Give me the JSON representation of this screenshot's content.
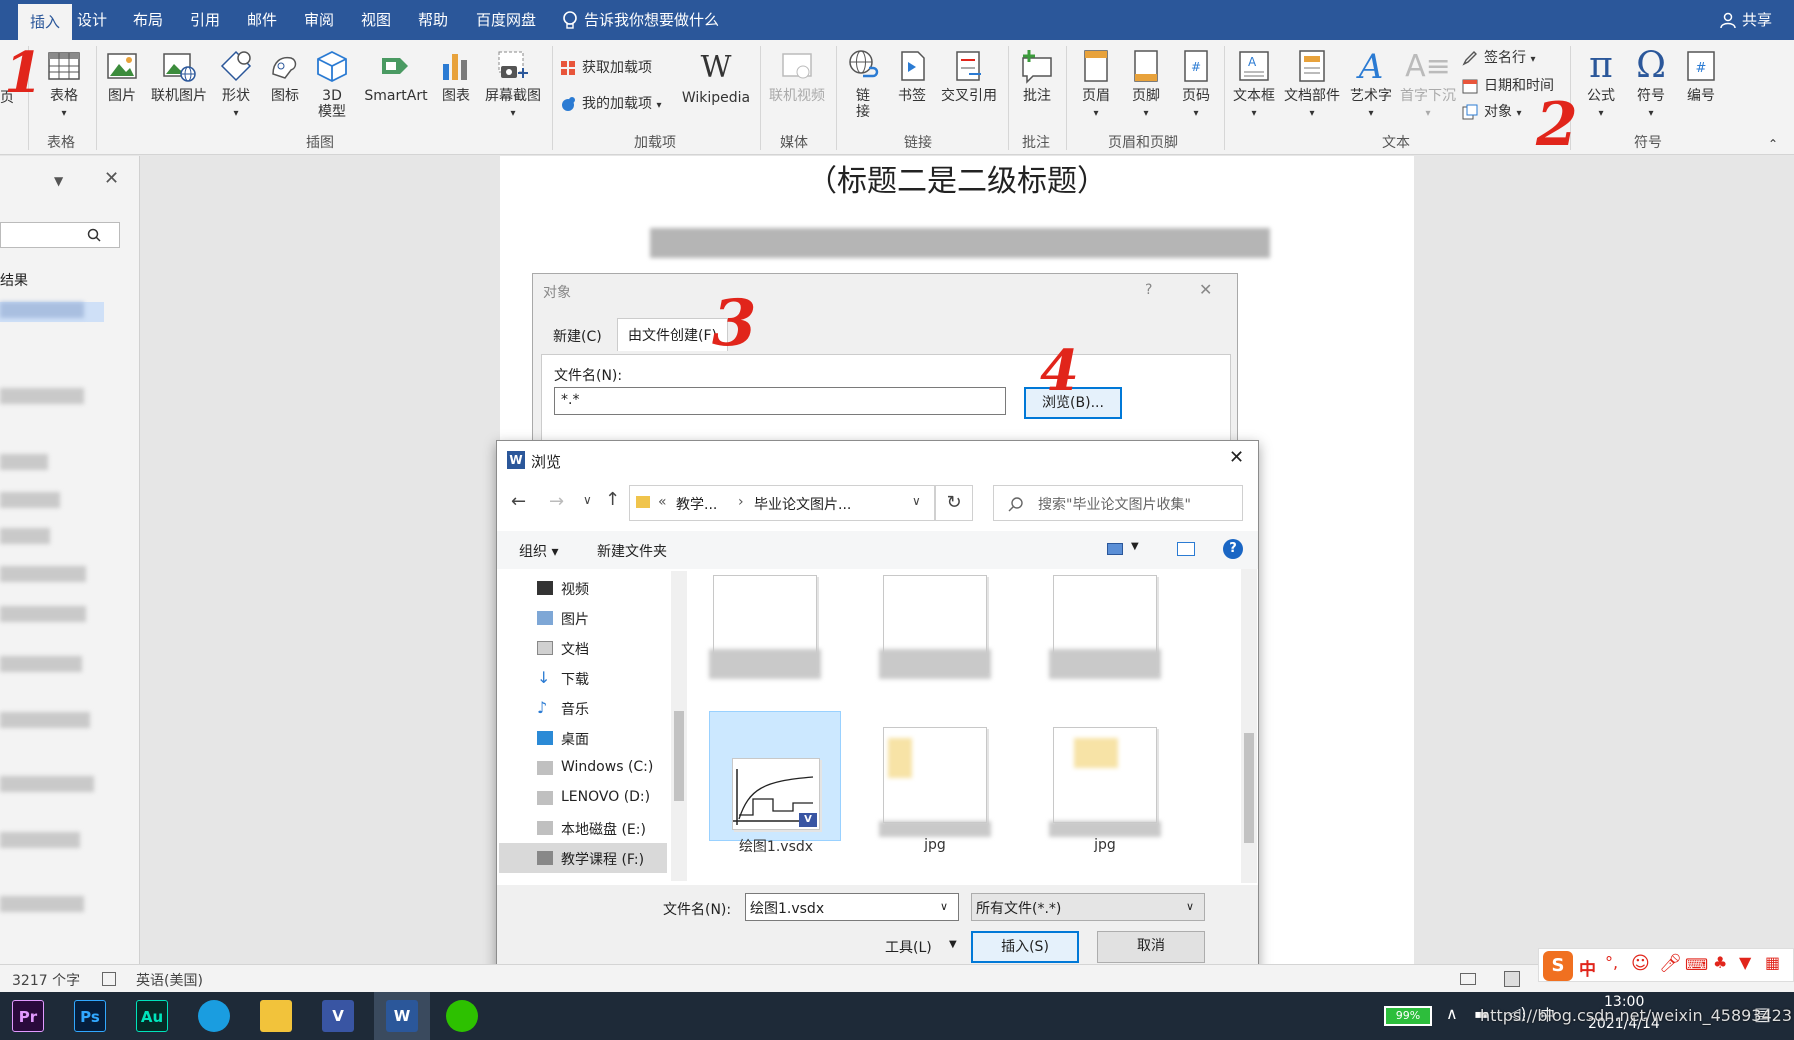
{
  "tabs": [
    "插入",
    "设计",
    "布局",
    "引用",
    "邮件",
    "审阅",
    "视图",
    "帮助",
    "百度网盘"
  ],
  "tell_me": "告诉我你想要做什么",
  "share": "共享",
  "ribbon": {
    "page_partial": "页",
    "table": "表格",
    "picture": "图片",
    "online_picture": "联机图片",
    "shapes": "形状",
    "icons": "图标",
    "model3d_line1": "3D",
    "model3d_line2": "模型",
    "smartart": "SmartArt",
    "chart": "图表",
    "screenshot": "屏幕截图",
    "get_addins": "获取加载项",
    "my_addins": "我的加载项",
    "wikipedia": "Wikipedia",
    "online_video": "联机视频",
    "link_line1": "链",
    "link_line2": "接",
    "bookmark": "书签",
    "crossref": "交叉引用",
    "comment": "批注",
    "header": "页眉",
    "footer": "页脚",
    "page_number": "页码",
    "textbox": "文本框",
    "quickparts": "文档部件",
    "wordart": "艺术字",
    "dropcap": "首字下沉",
    "signature": "签名行",
    "datetime": "日期和时间",
    "object": "对象",
    "equation": "公式",
    "symbol": "符号",
    "number": "编号",
    "groups": {
      "table": "表格",
      "illustrations": "插图",
      "addins": "加载项",
      "media": "媒体",
      "links": "链接",
      "comments": "批注",
      "header_footer": "页眉和页脚",
      "text": "文本",
      "symbols": "符号"
    }
  },
  "navpane": {
    "results": "结果"
  },
  "document": {
    "heading": "（标题二是二级标题）"
  },
  "object_dialog": {
    "title": "对象",
    "help": "?",
    "close": "✕",
    "tab_new": "新建(C)",
    "tab_from_file": "由文件创建(F)",
    "filename_label": "文件名(N):",
    "filename_value": "*.*",
    "browse_btn": "浏览(B)..."
  },
  "browse_dialog": {
    "title": "浏览",
    "close": "✕",
    "path": [
      "«",
      "教学...",
      "›",
      "毕业论文图片..."
    ],
    "search_placeholder": "搜索\"毕业论文图片收集\"",
    "organize": "组织 ▾",
    "new_folder": "新建文件夹",
    "tree": [
      "视频",
      "图片",
      "文档",
      "下载",
      "音乐",
      "桌面",
      "Windows (C:)",
      "LENOVO (D:)",
      "本地磁盘 (E:)",
      "教学课程 (F:)"
    ],
    "files": [
      {
        "caption": ""
      },
      {
        "caption": ""
      },
      {
        "caption": ""
      },
      {
        "caption": "绘图1.vsdx",
        "selected": true
      },
      {
        "caption": "jpg"
      },
      {
        "caption": "jpg"
      }
    ],
    "filename_label": "文件名(N):",
    "filename_value": "绘图1.vsdx",
    "filetype_value": "所有文件(*.*)",
    "tools": "工具(L)",
    "insert": "插入(S)",
    "cancel": "取消"
  },
  "statusbar": {
    "word_count": "3217 个字",
    "language": "英语(美国)"
  },
  "taskbar": {
    "apps": [
      "Pr",
      "Ps",
      "Au",
      "Edge",
      "Explorer",
      "Visio",
      "Word",
      "WeChat"
    ],
    "battery": "99%",
    "time": "13:00",
    "date": "2021/4/14",
    "watermark": "https://blog.csdn.net/weixin_45893423",
    "ime": "中"
  },
  "annotations": [
    "1",
    "2",
    "3",
    "4"
  ],
  "colors": {
    "ribbon_blue": "#2b579a",
    "annotation_red": "#e1251b",
    "selection_blue": "#cce8ff",
    "primary_border": "#0078d7"
  }
}
